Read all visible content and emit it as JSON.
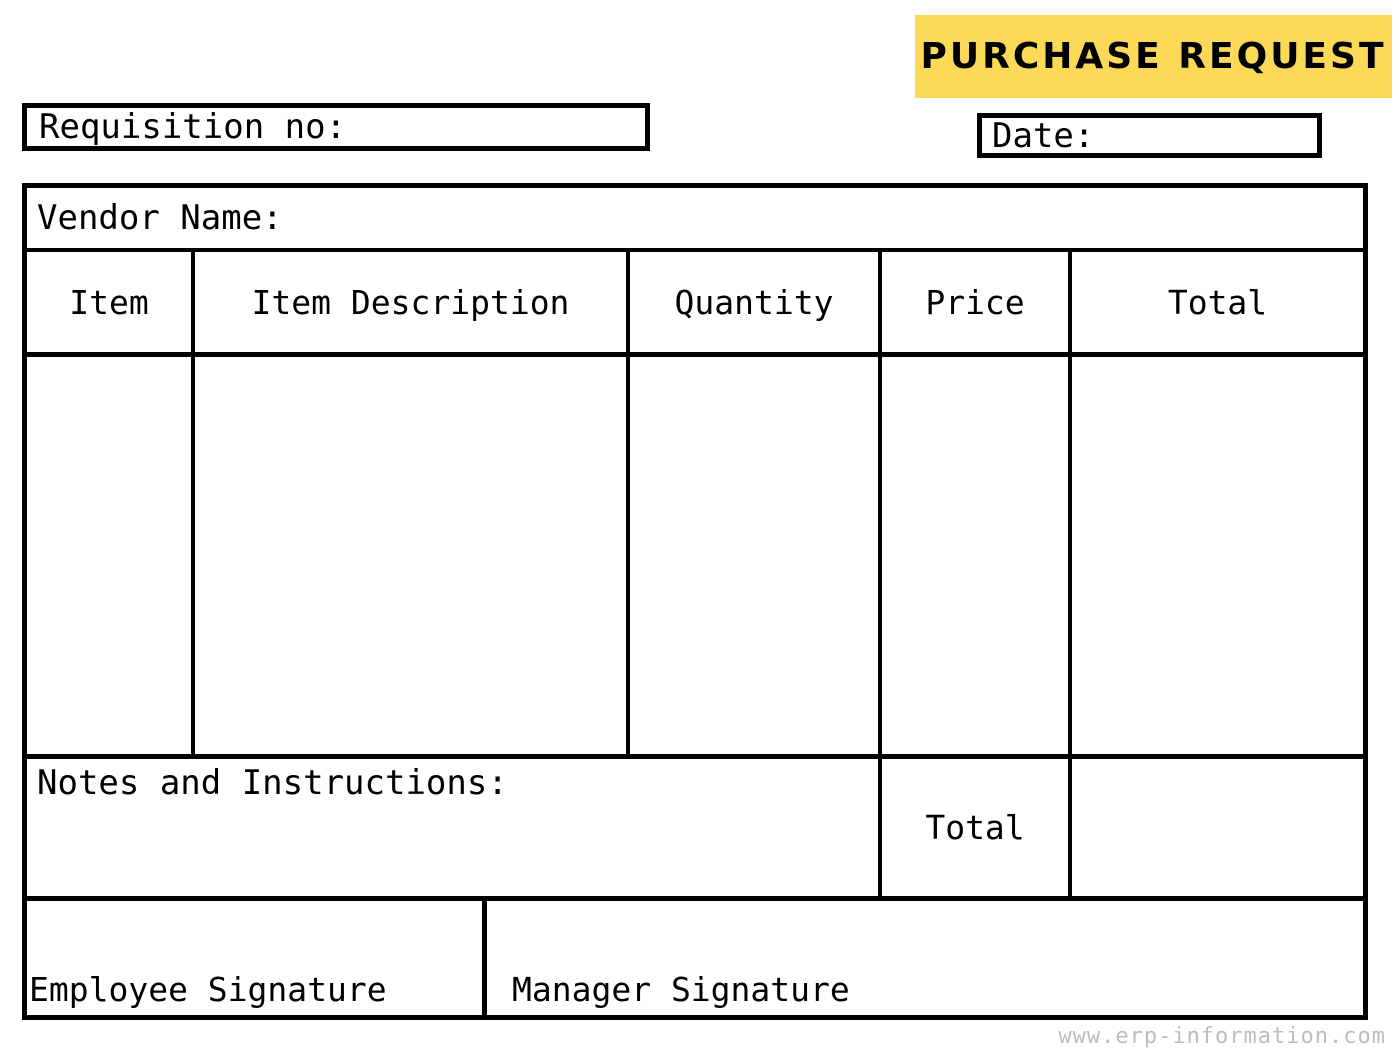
{
  "document": {
    "title_banner": {
      "label": "PURCHASE REQUEST",
      "background_color": "#fcda57",
      "text_color": "#000000"
    },
    "header_fields": [
      {
        "name": "requisition_no",
        "label": "Requisition no:",
        "value": ""
      },
      {
        "name": "date",
        "label": "Date:",
        "value": ""
      }
    ],
    "vendor": {
      "label": "Vendor Name:",
      "value": ""
    },
    "table": {
      "columns": [
        {
          "key": "item",
          "header": "Item"
        },
        {
          "key": "description",
          "header": "Item Description"
        },
        {
          "key": "quantity",
          "header": "Quantity"
        },
        {
          "key": "price",
          "header": "Price"
        },
        {
          "key": "total",
          "header": "Total"
        }
      ],
      "rows": []
    },
    "notes": {
      "label": "Notes and Instructions:",
      "value": ""
    },
    "grand_total": {
      "label": "Total",
      "value": ""
    },
    "signatures": [
      {
        "name": "employee_signature",
        "label": "Employee Signature",
        "value": ""
      },
      {
        "name": "manager_signature",
        "label": "Manager Signature",
        "value": ""
      }
    ],
    "footer": {
      "url_text": "www.erp-information.com",
      "color": "#bdbdbd"
    }
  }
}
